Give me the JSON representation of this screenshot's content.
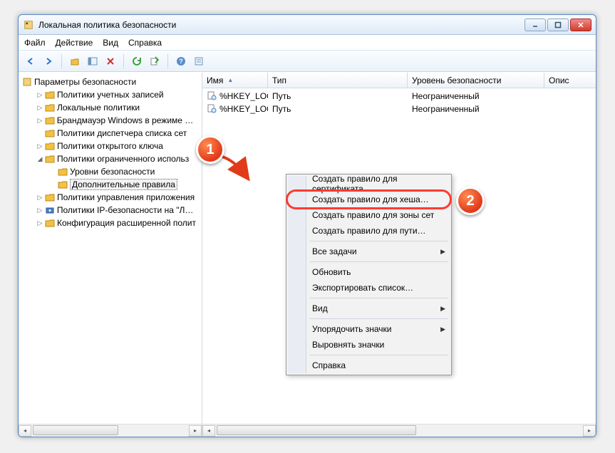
{
  "window": {
    "title": "Локальная политика безопасности"
  },
  "menu": {
    "file": "Файл",
    "action": "Действие",
    "view": "Вид",
    "help": "Справка"
  },
  "tree": {
    "root": "Параметры безопасности",
    "items": [
      {
        "twist": "▷",
        "indent": 1,
        "icon": "folder",
        "label": "Политики учетных записей"
      },
      {
        "twist": "▷",
        "indent": 1,
        "icon": "folder",
        "label": "Локальные политики"
      },
      {
        "twist": "▷",
        "indent": 1,
        "icon": "folder",
        "label": "Брандмауэр Windows в режиме пов"
      },
      {
        "twist": "",
        "indent": 1,
        "icon": "folder",
        "label": "Политики диспетчера списка сет"
      },
      {
        "twist": "▷",
        "indent": 1,
        "icon": "folder",
        "label": "Политики открытого ключа"
      },
      {
        "twist": "◢",
        "indent": 1,
        "icon": "folder",
        "label": "Политики ограниченного использ"
      },
      {
        "twist": "",
        "indent": 2,
        "icon": "folder",
        "label": "Уровни безопасности"
      },
      {
        "twist": "",
        "indent": 2,
        "icon": "folder",
        "label": "Дополнительные правила",
        "selected": true
      },
      {
        "twist": "▷",
        "indent": 1,
        "icon": "folder",
        "label": "Политики управления приложения"
      },
      {
        "twist": "▷",
        "indent": 1,
        "icon": "ipsec",
        "label": "Политики IP-безопасности на \"Лока"
      },
      {
        "twist": "▷",
        "indent": 1,
        "icon": "folder",
        "label": "Конфигурация расширенной полит"
      }
    ]
  },
  "columns": {
    "name": "Имя",
    "type": "Тип",
    "level": "Уровень безопасности",
    "desc": "Опис"
  },
  "rows": [
    {
      "name": "%HKEY_LOC…",
      "type": "Путь",
      "level": "Неограниченный"
    },
    {
      "name": "%HKEY_LOC…",
      "type": "Путь",
      "level": "Неограниченный"
    }
  ],
  "context_menu": {
    "cert": "Создать правило для сертификата…",
    "hash": "Создать правило для хеша…",
    "zone": "Создать правило для зоны сет",
    "path": "Создать правило для пути…",
    "all_tasks": "Все задачи",
    "refresh": "Обновить",
    "export": "Экспортировать список…",
    "view": "Вид",
    "arrange": "Упорядочить значки",
    "align": "Выровнять значки",
    "help": "Справка"
  },
  "annotations": {
    "badge1": "1",
    "badge2": "2"
  }
}
